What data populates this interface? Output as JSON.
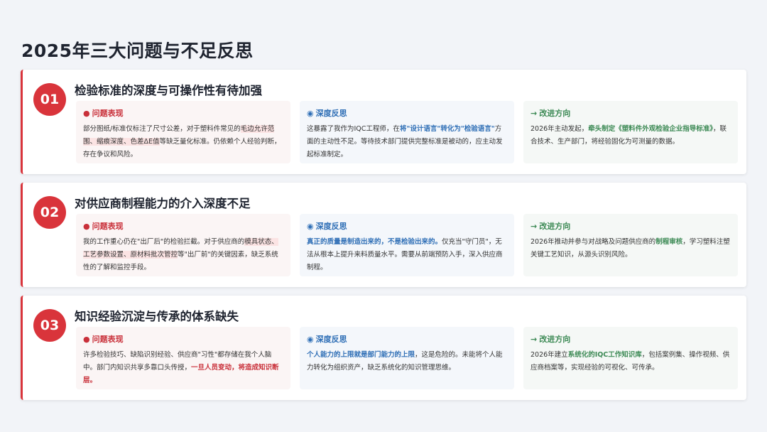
{
  "page": {
    "title": "2025年三大问题与不足反思"
  },
  "labels": {
    "problem": "问题表现",
    "reflect": "深度反思",
    "improve": "改进方向"
  },
  "icons": {
    "problem": "alert-circle-icon",
    "reflect": "brain-icon",
    "improve": "arrow-right-icon"
  },
  "colors": {
    "accent_red": "#d9343b",
    "blue": "#2f6fb6",
    "green": "#3d8a55"
  },
  "issues": [
    {
      "number": "01",
      "title": "检验标准的深度与可操作性有待加强",
      "problem": {
        "p1": "部分图纸/标准仅标注了尺寸公差，对于塑料件常见的",
        "hl": "毛边允许范围、缩痕深度、色差ΔE值",
        "p2": "等缺乏量化标准。仍依赖个人经验判断，存在争议和风险。"
      },
      "reflect": {
        "p1": "这暴露了我作为IQC工程师，在",
        "em": "将\"设计语言\"转化为\"检验语言\"",
        "p2": "方面的主动性不足。等待技术部门提供完整标准是被动的，应主动发起标准制定。"
      },
      "improve": {
        "p1": "2026年主动发起，",
        "em": "牵头制定《塑料件外观检验企业指导标准》",
        "p2": "，联合技术、生产部门，将经验固化为可测量的数据。"
      }
    },
    {
      "number": "02",
      "title": "对供应商制程能力的介入深度不足",
      "problem": {
        "p1": "我的工作重心仍在\"出厂后\"的检验拦截。对于供应商的",
        "hl": "模具状态、工艺参数设置、原材料批次管控",
        "p2": "等\"出厂前\"的关键因素，缺乏系统性的了解和监控手段。"
      },
      "reflect": {
        "p1": "",
        "em": "真正的质量是制造出来的，不是检验出来的。",
        "p2": "仅充当\"守门员\"，无法从根本上提升来料质量水平。需要从前端预防入手，深入供应商制程。"
      },
      "improve": {
        "p1": "2026年推动并参与对战略及问题供应商的",
        "em": "制程审核",
        "p2": "，学习塑料注塑关键工艺知识，从源头识别风险。"
      }
    },
    {
      "number": "03",
      "title": "知识经验沉淀与传承的体系缺失",
      "problem": {
        "p1": "许多检验技巧、缺陷识别经验、供应商\"习性\"都存储在我个人脑中。部门内知识共享多靠口头传授，",
        "hl": "一旦人员变动，将造成知识断层。",
        "p2": ""
      },
      "reflect": {
        "p1": "",
        "em": "个人能力的上限就是部门能力的上限",
        "p2": "，这是危险的。未能将个人能力转化为组织资产，缺乏系统化的知识管理思维。"
      },
      "improve": {
        "p1": "2026年建立",
        "em": "系统化的IQC工作知识库",
        "p2": "，包括案例集、操作视频、供应商档案等，实现经验的可视化、可传承。"
      }
    }
  ]
}
